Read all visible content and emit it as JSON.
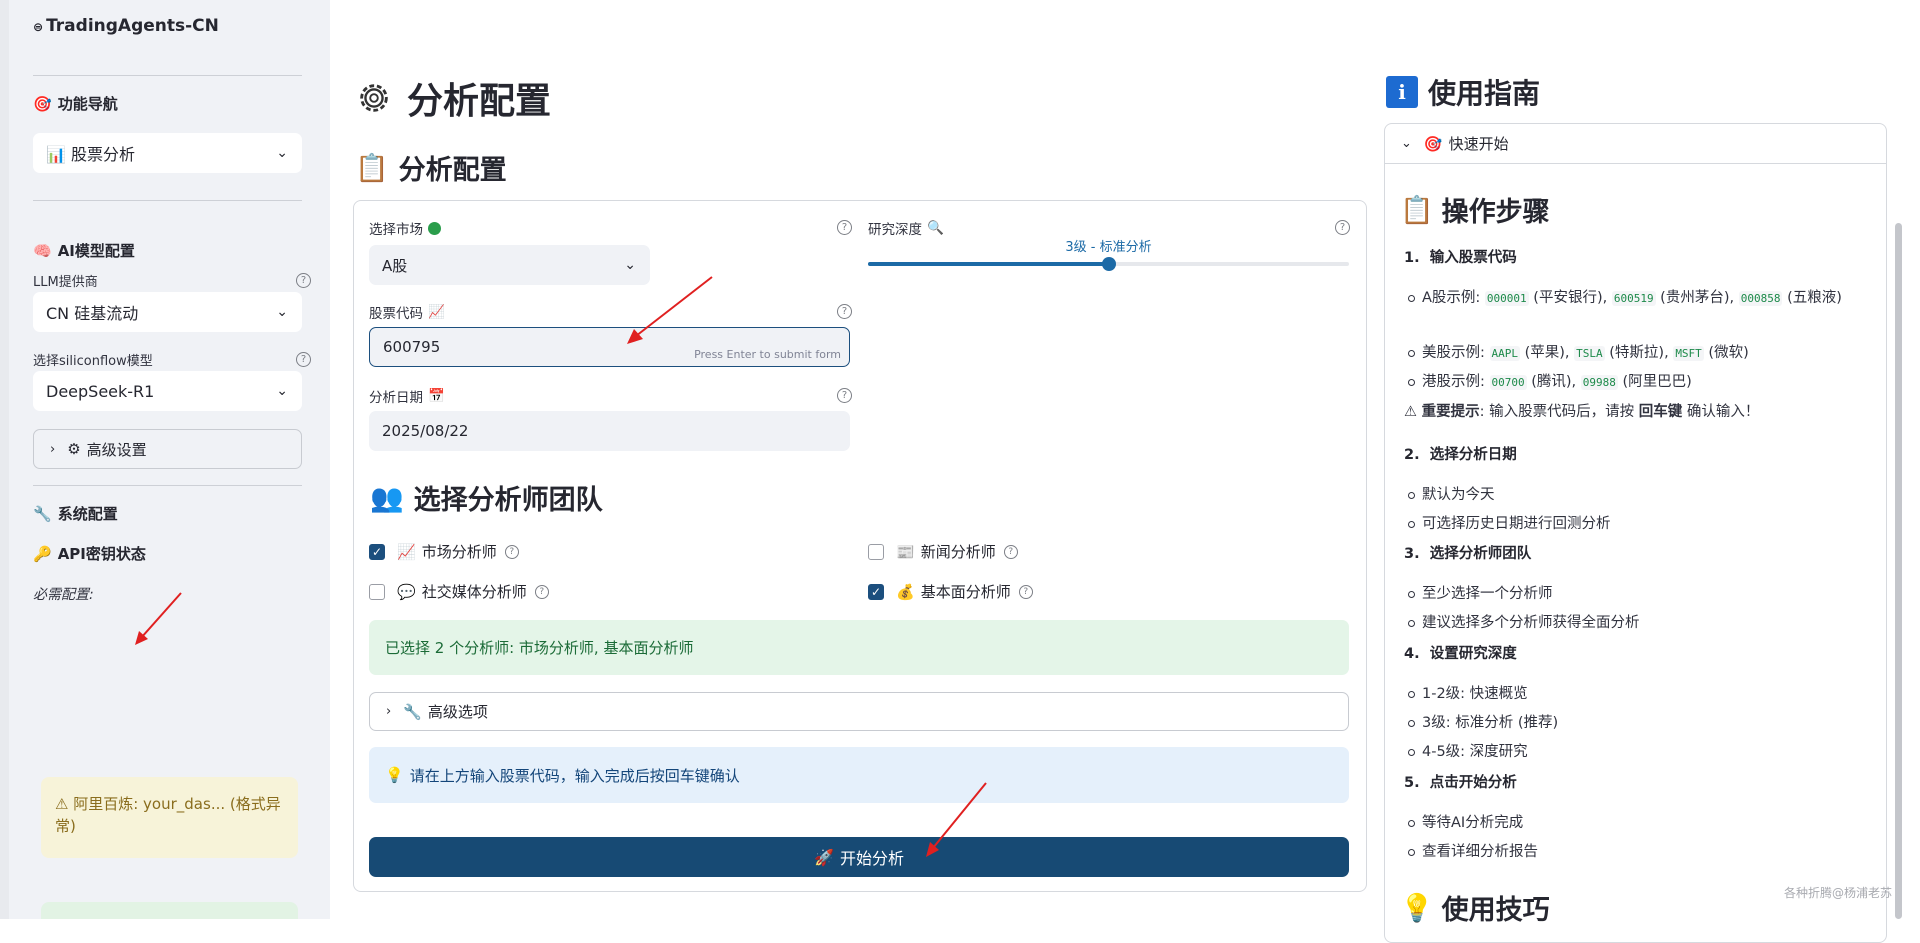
{
  "sidebar": {
    "app_title": "TradingAgents-CN",
    "nav_heading": "功能导航",
    "nav_select": "📊 股票分析",
    "ai_heading": "AI模型配置",
    "llm_label": "LLM提供商",
    "llm_value": "CN 硅基流动",
    "model_label": "选择siliconflow模型",
    "model_value": "DeepSeek-R1",
    "advanced_label": "高级设置",
    "system_heading": "系统配置",
    "api_heading": "API密钥状态",
    "required_label": "必需配置:",
    "warning_text": "阿里百炼: your_das... (格式异常)"
  },
  "main": {
    "page_title": "分析配置",
    "section_title": "分析配置",
    "market_label": "选择市场",
    "market_value": "A股",
    "depth_label": "研究深度",
    "depth_value_label": "3级 - 标准分析",
    "depth_level": 3,
    "depth_min": 1,
    "depth_max": 5,
    "stock_label": "股票代码",
    "stock_value": "600795",
    "stock_hint": "Press Enter to submit form",
    "date_label": "分析日期",
    "date_value": "2025/08/22",
    "team_title": "选择分析师团队",
    "analysts": [
      {
        "label": "市场分析师",
        "checked": true
      },
      {
        "label": "新闻分析师",
        "checked": false
      },
      {
        "label": "社交媒体分析师",
        "checked": false
      },
      {
        "label": "基本面分析师",
        "checked": true
      }
    ],
    "selected_msg": "已选择 2 个分析师: 市场分析师, 基本面分析师",
    "advanced_options": "高级选项",
    "info_msg": "请在上方输入股票代码，输入完成后按回车键确认",
    "start_button": "开始分析",
    "help_char": "?"
  },
  "guide": {
    "title": "使用指南",
    "quick_start": "快速开始",
    "steps_title": "操作步骤",
    "step1": "输入股票代码",
    "s1_a_prefix": "A股示例: ",
    "s1_a_c1": "000001",
    "s1_a_t1": " (平安银行), ",
    "s1_a_c2": "600519",
    "s1_a_t2": " (贵州茅台), ",
    "s1_a_c3": "000858",
    "s1_a_t3": " (五粮液)",
    "s1_us_prefix": "美股示例: ",
    "s1_us_c1": "AAPL",
    "s1_us_t1": " (苹果), ",
    "s1_us_c2": "TSLA",
    "s1_us_t2": " (特斯拉), ",
    "s1_us_c3": "MSFT",
    "s1_us_t3": " (微软)",
    "s1_hk_prefix": "港股示例: ",
    "s1_hk_c1": "00700",
    "s1_hk_t1": " (腾讯), ",
    "s1_hk_c2": "09988",
    "s1_hk_t2": " (阿里巴巴)",
    "s1_tip_bold": "重要提示",
    "s1_tip_a": ": 输入股票代码后，请按 ",
    "s1_tip_key": "回车键",
    "s1_tip_b": " 确认输入！",
    "step2": "选择分析日期",
    "s2_a": "默认为今天",
    "s2_b": "可选择历史日期进行回测分析",
    "step3": "选择分析师团队",
    "s3_a": "至少选择一个分析师",
    "s3_b": "建议选择多个分析师获得全面分析",
    "step4": "设置研究深度",
    "s4_a": "1-2级: 快速概览",
    "s4_b": "3级: 标准分析 (推荐)",
    "s4_c": "4-5级: 深度研究",
    "step5": "点击开始分析",
    "s5_a": "等待AI分析完成",
    "s5_b": "查看详细分析报告",
    "tips_title": "使用技巧"
  },
  "watermark": "各种折腾@杨浦老苏",
  "colors": {
    "primary": "#174a74",
    "accent": "#1c6aa6",
    "success_bg": "#e4f5e8",
    "info_bg": "#e5f0fb",
    "warning_bg": "#f7f3d9",
    "annotation_arrow": "#e02020"
  }
}
